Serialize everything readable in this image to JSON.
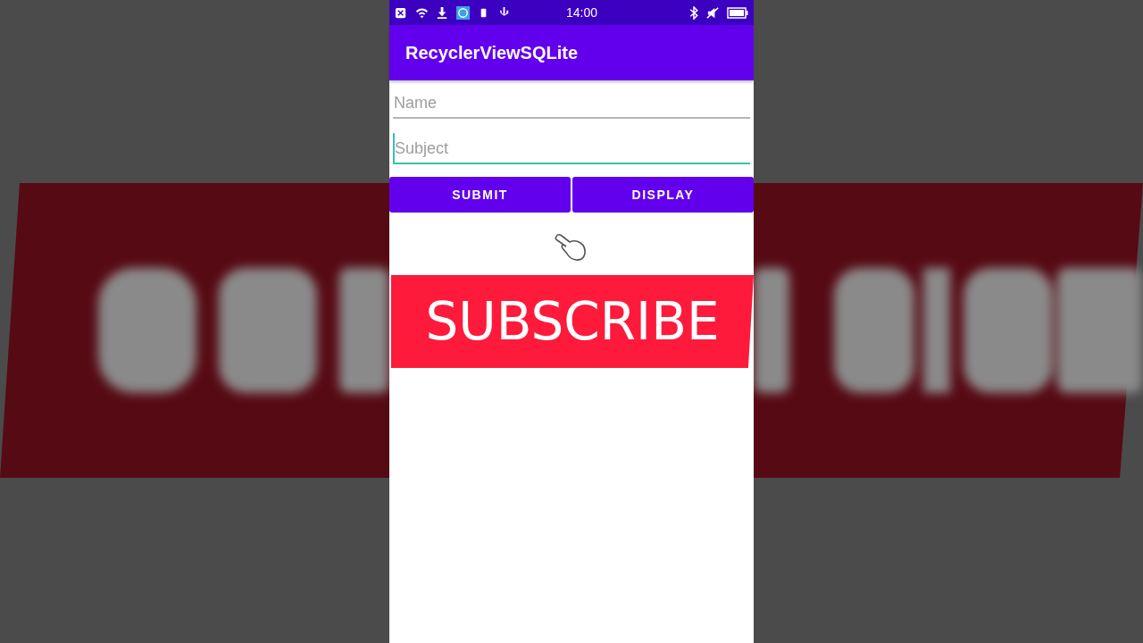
{
  "status_bar": {
    "time": "14:00"
  },
  "app_bar": {
    "title": "RecyclerViewSQLite"
  },
  "fields": [
    {
      "placeholder": "Name",
      "focused": false
    },
    {
      "placeholder": "Subject",
      "focused": true
    }
  ],
  "buttons": [
    "SUBMIT",
    "DISPLAY"
  ],
  "banner": {
    "text": "SUBSCRIBE"
  }
}
